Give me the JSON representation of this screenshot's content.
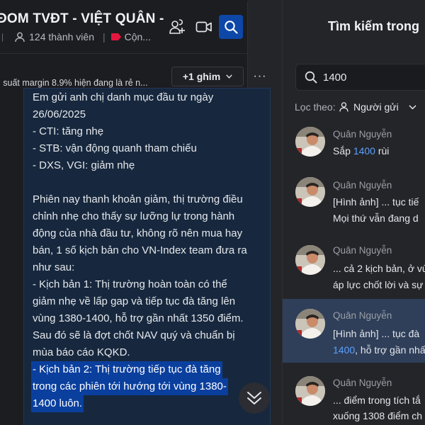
{
  "header": {
    "group_title": "ĐOM TVĐT - VIỆT QUÂN -",
    "member_count": "124 thành viên",
    "tag_label": "Cộn...",
    "icons": [
      "add-member-icon",
      "video-call-icon",
      "search-icon",
      "side-panel-icon"
    ],
    "accent_color": "#0d47a8"
  },
  "pinned": {
    "text": "i suất margin 8.9% hiện đang là rẻ n...",
    "pin_button": "+1 ghim",
    "more": "···"
  },
  "message": {
    "lines": [
      "Em gửi anh chị danh mục đầu tư ngày",
      "26/06/2025",
      "- CTI: tăng nhẹ",
      "- STB: vận động quanh tham chiếu",
      "- DXS, VGI: giảm nhẹ",
      "",
      "Phiên nay thanh khoản giảm, thị trường điều",
      "chỉnh nhẹ cho thấy sự lưỡng lự trong hành",
      "động của nhà đầu tư, không rõ nên mua hay",
      "bán, 1 số kịch bản cho VN-Index team đưa ra",
      "như sau:",
      "- Kịch bản 1: Thị trường hoàn toàn có thể",
      "giảm nhẹ về lấp gap và tiếp tục đà tăng lên",
      "vùng 1380-1400, hỗ trợ gần nhất 1350 điểm.",
      "Sau đó sẽ là đợt chốt NAV quý và chuẩn bị",
      "mùa báo cáo KQKD.",
      "- Kịch bản 2: Thị trường tiếp tục đà tăng",
      "trong các phiên tới hướng tới vùng 1380-",
      "1400 luôn."
    ],
    "highlight_color": "#0a3f9e"
  },
  "search_panel": {
    "title": "Tìm kiếm trong",
    "query": "1400",
    "filter_label": "Lọc theo:",
    "sender_filter": "Người gửi",
    "keyword_color": "#5aa0ff",
    "results": [
      {
        "name": "Quân Nguyễn",
        "line1_before": "Sắp ",
        "line1_kw": "1400",
        "line1_after": " rùi",
        "line2_kw": "",
        "line2_after": ""
      },
      {
        "name": "Quân Nguyễn",
        "line1_before": "[Hình ảnh] ... tục tiế",
        "line1_kw": "",
        "line1_after": "",
        "line2_kw": "",
        "line2_after": "Mọi thứ vẫn đang d"
      },
      {
        "name": "Quân Nguyễn",
        "line1_before": "... cả 2 kịch bản, ở vù",
        "line1_kw": "",
        "line1_after": "",
        "line2_kw": "",
        "line2_after": "áp lực chốt lời và sự"
      },
      {
        "name": "Quân Nguyễn",
        "line1_before": "[Hình ảnh] ... tục đà",
        "line1_kw": "",
        "line1_after": "",
        "line2_kw": "1400",
        "line2_after": ", hỗ trợ gần nhấ"
      },
      {
        "name": "Quân Nguyễn",
        "line1_before": "... điểm trong tích tắ",
        "line1_kw": "",
        "line1_after": "",
        "line2_kw": "",
        "line2_after": "xuống 1308 điểm ch"
      }
    ]
  }
}
